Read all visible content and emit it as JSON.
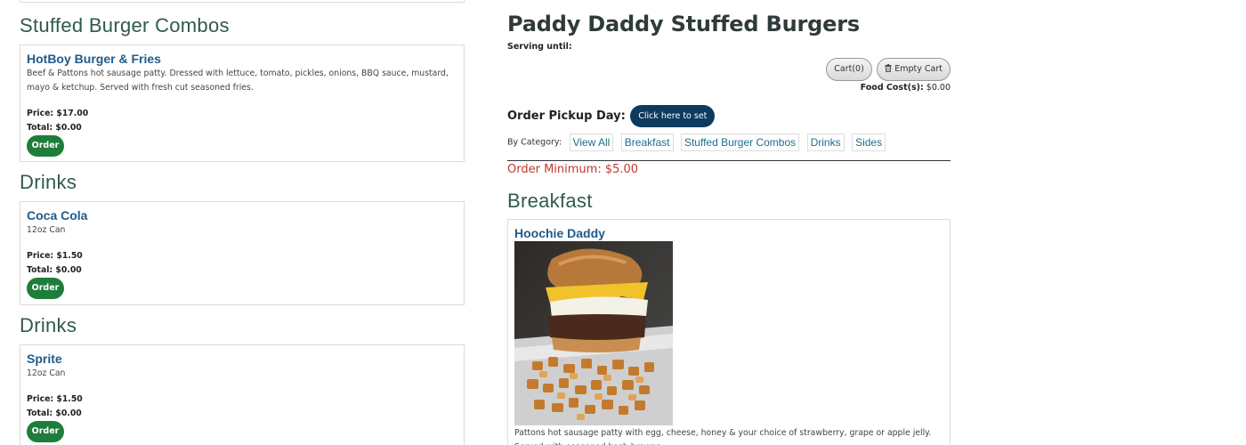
{
  "left": {
    "sections": [
      {
        "heading": "Stuffed Burger Combos",
        "item": {
          "title": "HotBoy Burger & Fries",
          "desc": "Beef & Pattons hot sausage patty. Dressed with lettuce, tomato, pickles, onions, BBQ sauce, mustard, mayo & ketchup. Served with fresh cut seasoned fries.",
          "price": "Price: $17.00",
          "total": "Total: $0.00",
          "order": "Order"
        }
      },
      {
        "heading": "Drinks",
        "item": {
          "title": "Coca Cola",
          "desc": "12oz Can",
          "price": "Price: $1.50",
          "total": "Total: $0.00",
          "order": "Order"
        }
      },
      {
        "heading": "Drinks",
        "item": {
          "title": "Sprite",
          "desc": "12oz Can",
          "price": "Price: $1.50",
          "total": "Total: $0.00",
          "order": "Order"
        }
      }
    ]
  },
  "right": {
    "title": "Paddy Daddy Stuffed Burgers",
    "serving_label": "Serving until:",
    "cart_label": "Cart(0)",
    "empty_cart_label": "Empty Cart",
    "food_cost_label": "Food Cost(s):",
    "food_cost_value": "$0.00",
    "pickup_label": "Order Pickup Day:",
    "set_button": "Click here to set",
    "by_category_label": "By Category:",
    "categories": [
      "View All",
      "Breakfast",
      "Stuffed Burger Combos",
      "Drinks",
      "Sides"
    ],
    "order_minimum": "Order Minimum: $5.00",
    "section_heading": "Breakfast",
    "item": {
      "title": "Hoochie Daddy",
      "desc": "Pattons hot sausage patty with egg, cheese, honey & your choice of strawberry, grape or apple jelly. Served with seasoned hash browns."
    }
  },
  "colors": {
    "heading": "#2f5a4f",
    "item_title": "#1f5a8a",
    "order_button": "#1e7d3a",
    "set_button": "#0d3b5e",
    "minimum": "#c0392b",
    "category_link": "#1b6f8c"
  },
  "icons": {
    "empty_cart": "trash-icon"
  }
}
